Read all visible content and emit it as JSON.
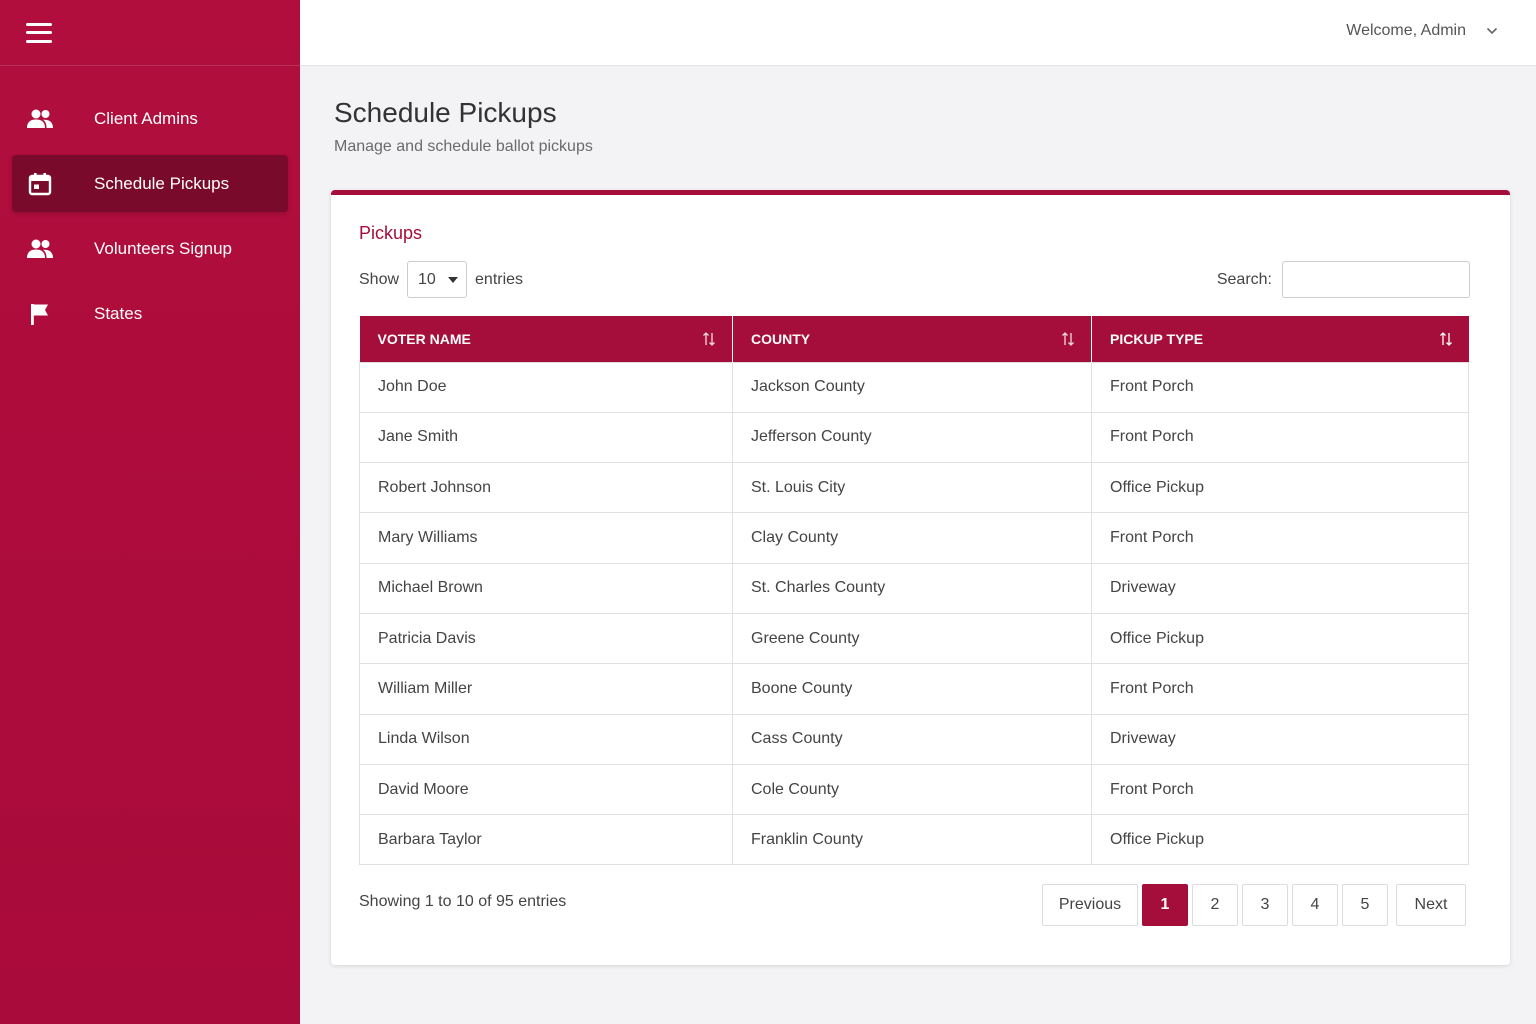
{
  "header": {
    "welcome": "Welcome, Admin"
  },
  "sidebar": {
    "items": [
      {
        "label": "Client Admins",
        "icon": "people-icon",
        "active": false
      },
      {
        "label": "Schedule Pickups",
        "icon": "calendar-icon",
        "active": true
      },
      {
        "label": "Volunteers Signup",
        "icon": "people-icon",
        "active": false
      },
      {
        "label": "States",
        "icon": "flag-icon",
        "active": false
      }
    ]
  },
  "page": {
    "title": "Schedule Pickups",
    "subtitle": "Manage and schedule ballot pickups"
  },
  "card": {
    "title": "Pickups",
    "show_label": "Show",
    "entries_value": "10",
    "entries_label": "entries",
    "search_label": "Search:",
    "search_value": ""
  },
  "table": {
    "columns": [
      "VOTER NAME",
      "COUNTY",
      "PICKUP TYPE"
    ],
    "rows": [
      [
        "John Doe",
        "Jackson County",
        "Front Porch"
      ],
      [
        "Jane Smith",
        "Jefferson County",
        "Front Porch"
      ],
      [
        "Robert Johnson",
        "St. Louis City",
        "Office Pickup"
      ],
      [
        "Mary Williams",
        "Clay County",
        "Front Porch"
      ],
      [
        "Michael Brown",
        "St. Charles County",
        "Driveway"
      ],
      [
        "Patricia Davis",
        "Greene County",
        "Office Pickup"
      ],
      [
        "William Miller",
        "Boone County",
        "Front Porch"
      ],
      [
        "Linda Wilson",
        "Cass County",
        "Driveway"
      ],
      [
        "David Moore",
        "Cole County",
        "Front Porch"
      ],
      [
        "Barbara Taylor",
        "Franklin County",
        "Office Pickup"
      ]
    ]
  },
  "footer": {
    "info": "Showing 1 to 10 of 95 entries",
    "previous": "Previous",
    "next": "Next",
    "pages": [
      "1",
      "2",
      "3",
      "4",
      "5"
    ],
    "current_page": "1"
  },
  "colors": {
    "brand": "#a50d3a",
    "sidebar": "#b10e3d",
    "active_item": "#7a0a2c"
  }
}
